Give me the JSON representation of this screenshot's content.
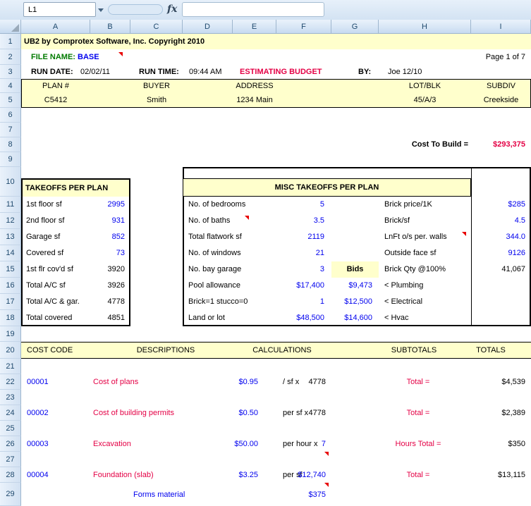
{
  "name_box": "L1",
  "fx_label": "fx",
  "colors": {
    "accent_red": "#e40045",
    "value_blue": "#0000ee",
    "label_green": "#007a00",
    "fill_yellow": "#ffffcc"
  },
  "grid": {
    "columns": [
      "A",
      "B",
      "C",
      "D",
      "E",
      "F",
      "G",
      "H",
      "I"
    ],
    "row_numbers": [
      "1",
      "2",
      "3",
      "4",
      "5",
      "6",
      "7",
      "8",
      "9",
      "10",
      "11",
      "12",
      "13",
      "14",
      "15",
      "16",
      "17",
      "18",
      "19",
      "20",
      "21",
      "22",
      "23",
      "24",
      "25",
      "26",
      "27",
      "28",
      "29"
    ]
  },
  "title_row": "UB2 by Comprotex Software, Inc. Copyright 2010",
  "file_row": {
    "label": "FILE NAME:",
    "value": "BASE",
    "page": "Page 1 of 7"
  },
  "run_row": {
    "date_label": "RUN DATE:",
    "date": "02/02/11",
    "time_label": "RUN TIME:",
    "time": "09:44 AM",
    "budget": "ESTIMATING BUDGET",
    "by_label": "BY:",
    "by": "Joe 12/10"
  },
  "plan_table": {
    "headers": [
      "PLAN #",
      "BUYER",
      "ADDRESS",
      "LOT/BLK",
      "SUBDIV"
    ],
    "values": [
      "C5412",
      "Smith",
      "1234 Main",
      "45/A/3",
      "Creekside"
    ]
  },
  "cost_to_build": {
    "label": "Cost To Build =",
    "value": "$293,375"
  },
  "takeoffs": {
    "title": "TAKEOFFS PER PLAN",
    "rows": [
      {
        "label": "1st floor sf",
        "value": "2995"
      },
      {
        "label": "2nd floor sf",
        "value": "931"
      },
      {
        "label": "Garage sf",
        "value": "852"
      },
      {
        "label": "Covered sf",
        "value": "73"
      },
      {
        "label": "1st flr cov'd sf",
        "value": "3920"
      },
      {
        "label": "Total A/C sf",
        "value": "3926"
      },
      {
        "label": "Total A/C & gar.",
        "value": "4778"
      },
      {
        "label": "Total covered",
        "value": "4851"
      }
    ]
  },
  "misc": {
    "title": "MISC TAKEOFFS PER PLAN",
    "bids_label": "Bids",
    "left": [
      {
        "label": "No. of bedrooms",
        "value": "5"
      },
      {
        "label": "No. of baths",
        "value": "3.5"
      },
      {
        "label": "Total flatwork sf",
        "value": "2119"
      },
      {
        "label": "No. of windows",
        "value": "21"
      },
      {
        "label": "No. bay garage",
        "value": "3"
      },
      {
        "label": "Pool allowance",
        "value": "$17,400"
      },
      {
        "label": "Brick=1 stucco=0",
        "value": "1"
      },
      {
        "label": "Land or lot",
        "value": "$48,500"
      }
    ],
    "bids": [
      "$9,473",
      "$12,500",
      "$14,600"
    ],
    "right": [
      {
        "label": "Brick price/1K",
        "value": "$285"
      },
      {
        "label": "Brick/sf",
        "value": "4.5"
      },
      {
        "label": "LnFt o/s per. walls",
        "value": "344.0"
      },
      {
        "label": "Outside face sf",
        "value": "9126"
      },
      {
        "label": "Brick Qty @100%",
        "value": "41,067"
      },
      {
        "label": "<  Plumbing",
        "value": ""
      },
      {
        "label": "<  Electrical",
        "value": ""
      },
      {
        "label": "<  Hvac",
        "value": ""
      }
    ]
  },
  "cost_table": {
    "headers": [
      "COST CODE",
      "DESCRIPTIONS",
      "CALCULATIONS",
      "SUBTOTALS",
      "TOTALS"
    ],
    "rows": [
      {
        "code": "00001",
        "desc": "Cost of plans",
        "rate": "$0.95",
        "unit": "/ sf x",
        "qty": "4778",
        "sub": "Total  =",
        "total": "$4,539"
      },
      {
        "code": "00002",
        "desc": "Cost of building permits",
        "rate": "$0.50",
        "unit": "per sf x",
        "qty": "4778",
        "sub": "Total  =",
        "total": "$2,389"
      },
      {
        "code": "00003",
        "desc": "Excavation",
        "rate": "$50.00",
        "unit": "per hour x",
        "qty": "7",
        "sub": "Hours Total =",
        "total": "$350"
      },
      {
        "code": "00004",
        "desc": "Foundation (slab)",
        "rate": "$3.25",
        "unit": "per sf",
        "qty": "$12,740",
        "sub": "Total  =",
        "total": "$13,115"
      }
    ],
    "extra_row": {
      "desc": "Forms material",
      "qty": "$375"
    }
  }
}
